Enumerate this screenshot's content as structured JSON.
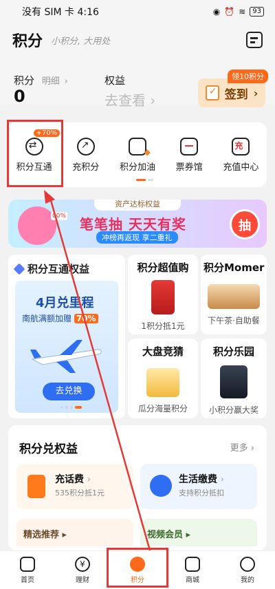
{
  "status": {
    "carrier": "没有 SIM 卡 4:16",
    "battery": "93"
  },
  "header": {
    "title": "积分",
    "slogan": "小积分, 大用处"
  },
  "points": {
    "label": "积分",
    "detail": "明细",
    "value": "0",
    "rights_label": "权益",
    "rights_value": "去查看"
  },
  "checkin": {
    "label": "签到",
    "badge": "领10积分"
  },
  "shortcuts": [
    {
      "label": "积分互通",
      "badge": "+70%",
      "icon": "exchange-icon"
    },
    {
      "label": "充积分",
      "icon": "charge-icon"
    },
    {
      "label": "积分加油",
      "icon": "fuel-icon"
    },
    {
      "label": "票券馆",
      "icon": "ticket-icon"
    },
    {
      "label": "充值中心",
      "icon": "recharge-icon"
    }
  ],
  "banner": {
    "tag": "资产达标权益",
    "title": "笔笔抽 天天有奖",
    "subtitle": "冲榜再返现 享二重礼",
    "button": "抽"
  },
  "exchange_card": {
    "title": "积分互通权益",
    "promo_title": "4月兑里程",
    "promo_sub": "南航满额加赠",
    "promo_badge": "70%",
    "promo_button": "去兑换"
  },
  "tiles": [
    {
      "title": "积分超值购",
      "sub": "1积分抵1元"
    },
    {
      "title": "积分Momer",
      "sub": "下午茶·自助餐"
    },
    {
      "title": "大盘竞猜",
      "sub": "瓜分海量积分"
    },
    {
      "title": "积分乐园",
      "sub": "小积分赢大奖"
    }
  ],
  "exchange_section": {
    "title": "积分兑权益",
    "more": "更多",
    "cards": [
      {
        "name": "充话费",
        "desc": "535积分抵1元"
      },
      {
        "name": "生活缴费",
        "desc": "支持积分抵扣"
      }
    ],
    "bottom": [
      "精选推荐",
      "视频会员"
    ]
  },
  "tabbar": [
    {
      "label": "首页",
      "icon": "home-icon"
    },
    {
      "label": "理财",
      "icon": "wealth-icon"
    },
    {
      "label": "积分",
      "icon": "points-icon",
      "active": true
    },
    {
      "label": "商城",
      "icon": "mall-icon"
    },
    {
      "label": "我的",
      "icon": "profile-icon"
    }
  ],
  "colors": {
    "accent": "#ff6a1a",
    "annotation": "#e53935"
  }
}
